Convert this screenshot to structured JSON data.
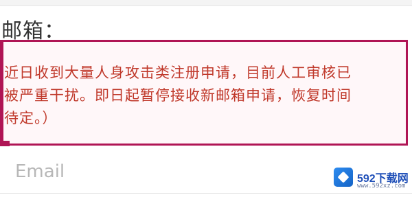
{
  "form": {
    "email_label": "邮箱：",
    "email_placeholder": "Email"
  },
  "notice": {
    "lines": [
      "近日收到大量人身攻击类注册申请，目前人工审核已",
      "被严重干扰。即日起暂停接收新邮箱申请，恢复时间",
      "待定。）"
    ]
  },
  "watermark": {
    "title": "592下载网",
    "subtitle": "www.592xz.com"
  },
  "colors": {
    "notice_border": "#b01555",
    "notice_text": "#c0392b",
    "placeholder": "#b7b7b7",
    "watermark_brand": "#1f4fb8"
  }
}
